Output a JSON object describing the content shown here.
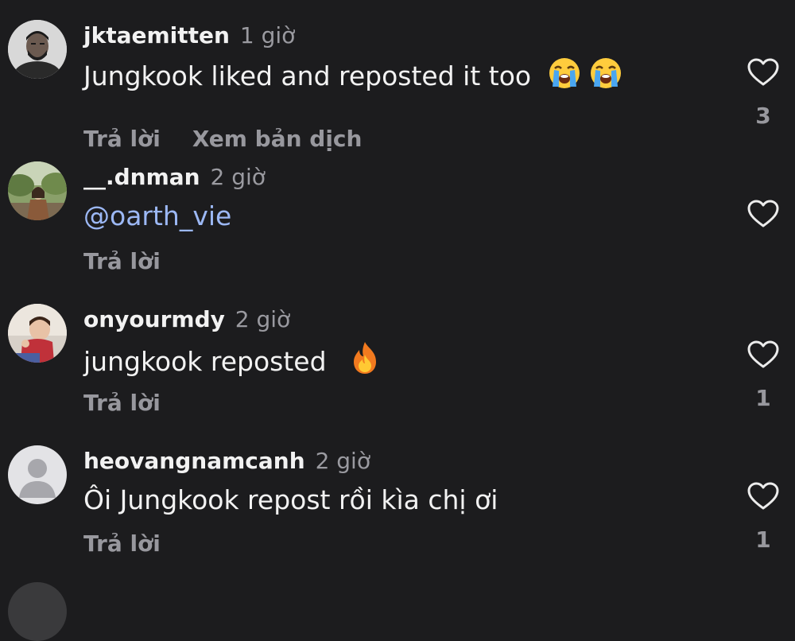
{
  "comments": [
    {
      "username": "jktaemitten",
      "time": "1 giờ",
      "text": "Jungkook liked and reposted it too",
      "emoji": [
        "😭",
        "😭"
      ],
      "reply_label": "Trả lời",
      "translate_label": "Xem bản dịch",
      "likes": "3"
    },
    {
      "username": "__.dnman",
      "time": "2 giờ",
      "text": "@oarth_vie",
      "reply_label": "Trả lời",
      "likes": ""
    },
    {
      "username": "onyourmdy",
      "time": "2 giờ",
      "text": "jungkook reposted",
      "emoji": [
        "🔥"
      ],
      "reply_label": "Trả lời",
      "likes": "1"
    },
    {
      "username": "heovangnamcanh",
      "time": "2 giờ",
      "text": "Ôi Jungkook repost rồi kìa chị ơi",
      "reply_label": "Trả lời",
      "likes": "1"
    }
  ],
  "colors": {
    "background": "#1c1c1e",
    "mention": "#9cb8f5",
    "secondary_text": "#98989e"
  },
  "icons": {
    "like": "heart-outline-icon",
    "crying": "loudly-crying-face-emoji",
    "fire": "fire-emoji"
  }
}
